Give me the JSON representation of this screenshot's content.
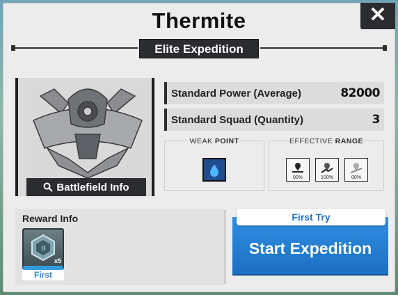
{
  "dialog": {
    "title": "Thermite",
    "subtitle": "Elite Expedition",
    "close_label": "✕"
  },
  "boss": {
    "battlefield_button": "Battlefield Info"
  },
  "stats": {
    "power_label": "Standard Power (Average)",
    "power_value": "82000",
    "squad_label": "Standard Squad (Quantity)",
    "squad_value": "3"
  },
  "weak_point": {
    "title_a": "WEAK",
    "title_b": "POINT",
    "icon": "water-drop-icon",
    "color": "#1f4d8f"
  },
  "effective_range": {
    "title_a": "EFFECTIVE",
    "title_b": "RANGE",
    "items": [
      {
        "icon": "range-near-icon",
        "pct": "00%"
      },
      {
        "icon": "range-mid-icon",
        "pct": "100%"
      },
      {
        "icon": "range-far-icon",
        "pct": "00%"
      }
    ]
  },
  "reward": {
    "label": "Reward Info",
    "item_count": "x5",
    "item_tag": "First"
  },
  "start": {
    "first_try_label": "First Try",
    "button_label": "Start Expedition",
    "accent": "#2f8fe0"
  }
}
